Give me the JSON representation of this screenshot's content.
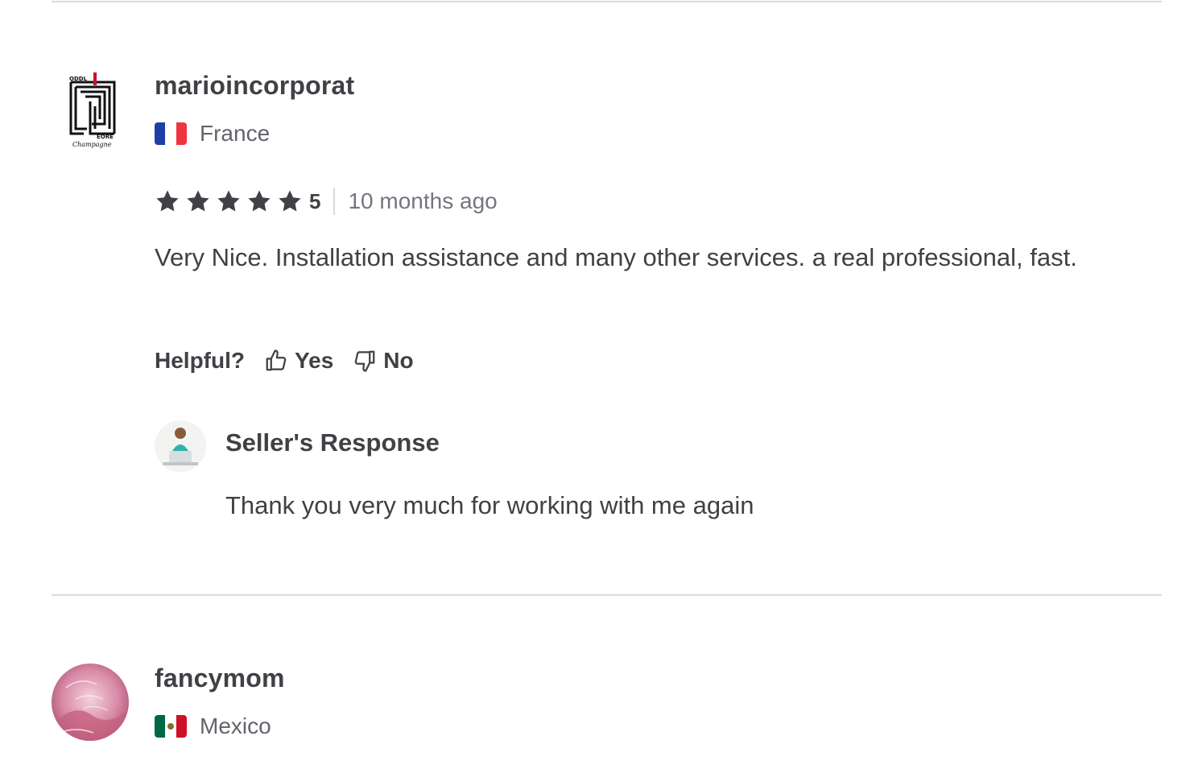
{
  "reviews": [
    {
      "username": "marioincorporat",
      "country": "France",
      "flag_colors": [
        "#1f3fa6",
        "#ffffff",
        "#ef3340"
      ],
      "avatar_icon": "champagne-brand-logo",
      "stars": 5,
      "rating": "5",
      "time_ago": "10 months ago",
      "text": "Very Nice. Installation assistance and many other services. a real professional, fast.",
      "helpful": {
        "label": "Helpful?",
        "yes_label": "Yes",
        "no_label": "No",
        "yes_icon": "thumbs-up-icon",
        "no_icon": "thumbs-down-icon"
      },
      "seller_response": {
        "title": "Seller's Response",
        "text": "Thank you very much for working with me again",
        "avatar_icon": "seller-avatar-photo"
      }
    },
    {
      "username": "fancymom",
      "country": "Mexico",
      "flag_colors": [
        "#006847",
        "#ffffff",
        "#ce1126"
      ],
      "avatar_icon": "pink-decorative-avatar"
    }
  ],
  "colors": {
    "text_primary": "#404145",
    "text_secondary": "#62646a",
    "divider": "#dadbdd",
    "star": "#404145"
  }
}
